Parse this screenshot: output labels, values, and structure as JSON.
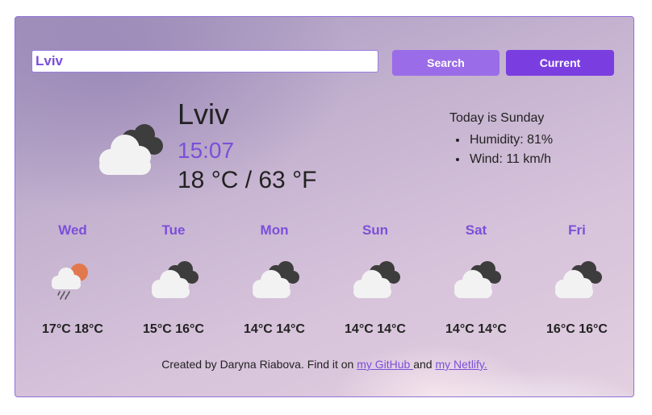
{
  "search": {
    "value": "Lviv",
    "search_label": "Search",
    "current_label": "Current"
  },
  "current": {
    "icon": "cloudy-icon",
    "city": "Lviv",
    "time": "15:07",
    "temperature": "18 °C / 63 °F",
    "today": "Today is Sunday",
    "humidity": "Humidity: 81%",
    "wind": "Wind: 11 km/h"
  },
  "forecast": [
    {
      "day": "Wed",
      "icon": "sun-rain-icon",
      "temps": "17°C 18°C"
    },
    {
      "day": "Tue",
      "icon": "cloudy-icon",
      "temps": "15°C 16°C"
    },
    {
      "day": "Mon",
      "icon": "cloudy-icon",
      "temps": "14°C 14°C"
    },
    {
      "day": "Sun",
      "icon": "cloudy-icon",
      "temps": "14°C 14°C"
    },
    {
      "day": "Sat",
      "icon": "cloudy-icon",
      "temps": "14°C 14°C"
    },
    {
      "day": "Fri",
      "icon": "cloudy-icon",
      "temps": "16°C 16°C"
    }
  ],
  "footer": {
    "text": "Created by Daryna Riabova. Find it on ",
    "github_link": "my GitHub ",
    "and": " and ",
    "netlify_link": "my Netlify."
  },
  "colors": {
    "accent": "#7b4fd9",
    "search_button": "#9b6ce8",
    "current_button": "#7a3ee0",
    "text": "#222222"
  }
}
